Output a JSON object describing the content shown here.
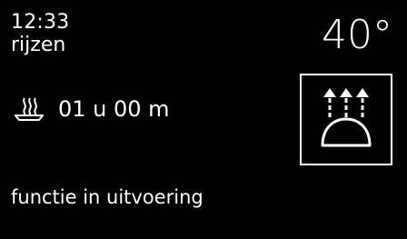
{
  "display": {
    "time": "12:33",
    "mode": "rijzen",
    "temperature": "40°",
    "duration": "01 u 00 m",
    "status": "functie in uitvoering"
  },
  "icons": {
    "timer": "steam-bowl-icon",
    "function": "dough-rising-icon"
  },
  "colors": {
    "background": "#000000",
    "foreground": "#ffffff"
  }
}
